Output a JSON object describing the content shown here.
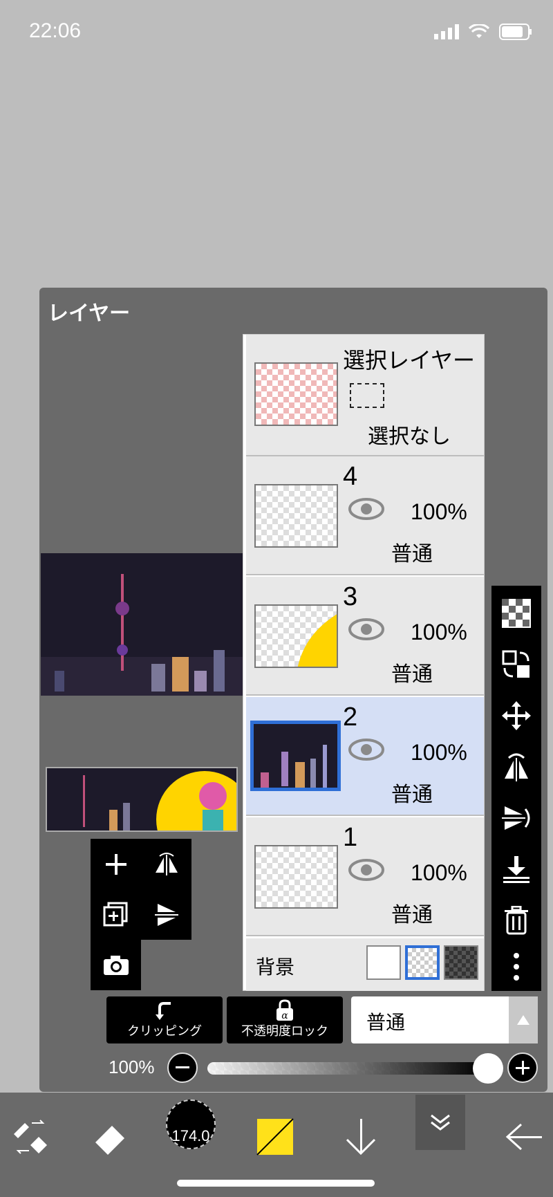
{
  "status": {
    "time": "22:06"
  },
  "panel": {
    "title": "レイヤー"
  },
  "selection_layer": {
    "title": "選択レイヤー",
    "state": "選択なし"
  },
  "layers": [
    {
      "num": "4",
      "opacity": "100%",
      "blend": "普通"
    },
    {
      "num": "3",
      "opacity": "100%",
      "blend": "普通"
    },
    {
      "num": "2",
      "opacity": "100%",
      "blend": "普通",
      "selected": true
    },
    {
      "num": "1",
      "opacity": "100%",
      "blend": "普通"
    }
  ],
  "background": {
    "label": "背景"
  },
  "buttons": {
    "clipping": "クリッピング",
    "alpha_lock": "不透明度ロック"
  },
  "blend_mode": {
    "value": "普通"
  },
  "opacity_slider": {
    "label": "100%",
    "value_percent": 100
  },
  "brush": {
    "size": "174.0"
  },
  "colors": {
    "selected": "#2f6fd6",
    "primary": "#ffe11a"
  }
}
